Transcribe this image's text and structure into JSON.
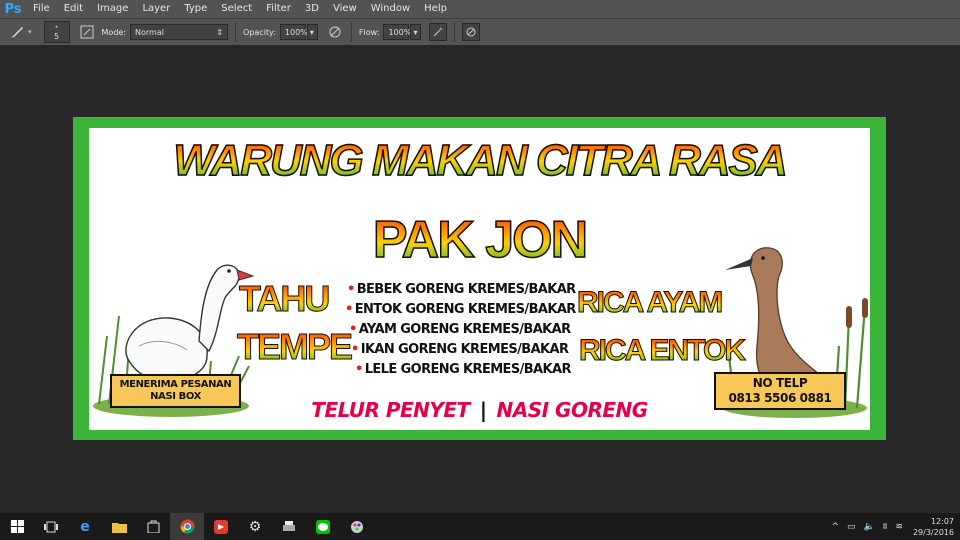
{
  "app": {
    "logo": "Ps"
  },
  "menu": [
    "File",
    "Edit",
    "Image",
    "Layer",
    "Type",
    "Select",
    "Filter",
    "3D",
    "View",
    "Window",
    "Help"
  ],
  "options": {
    "size": "5",
    "mode_label": "Mode:",
    "mode_value": "Normal",
    "opacity_label": "Opacity:",
    "opacity_value": "100%",
    "flow_label": "Flow:",
    "flow_value": "100%"
  },
  "banner": {
    "title": "WARUNG MAKAN CITRA RASA",
    "subtitle": "PAK JON",
    "left_words": [
      "TAHU",
      "TEMPE"
    ],
    "items": [
      "BEBEK GORENG KREMES/BAKAR",
      "ENTOK GORENG KREMES/BAKAR",
      "AYAM GORENG KREMES/BAKAR",
      "IKAN GORENG KREMES/BAKAR",
      "LELE GORENG KREMES/BAKAR"
    ],
    "right_words": [
      "RICA AYAM",
      "RICA ENTOK"
    ],
    "order_box": [
      "MENERIMA PESANAN",
      "NASI BOX"
    ],
    "phone_box": [
      "NO TELP",
      "0813 5506 0881"
    ],
    "bottom_left": "TELUR PENYET",
    "bottom_sep": "|",
    "bottom_right": "NASI GORENG"
  },
  "taskbar": {
    "time": "12:07",
    "date": "29/3/2016"
  }
}
